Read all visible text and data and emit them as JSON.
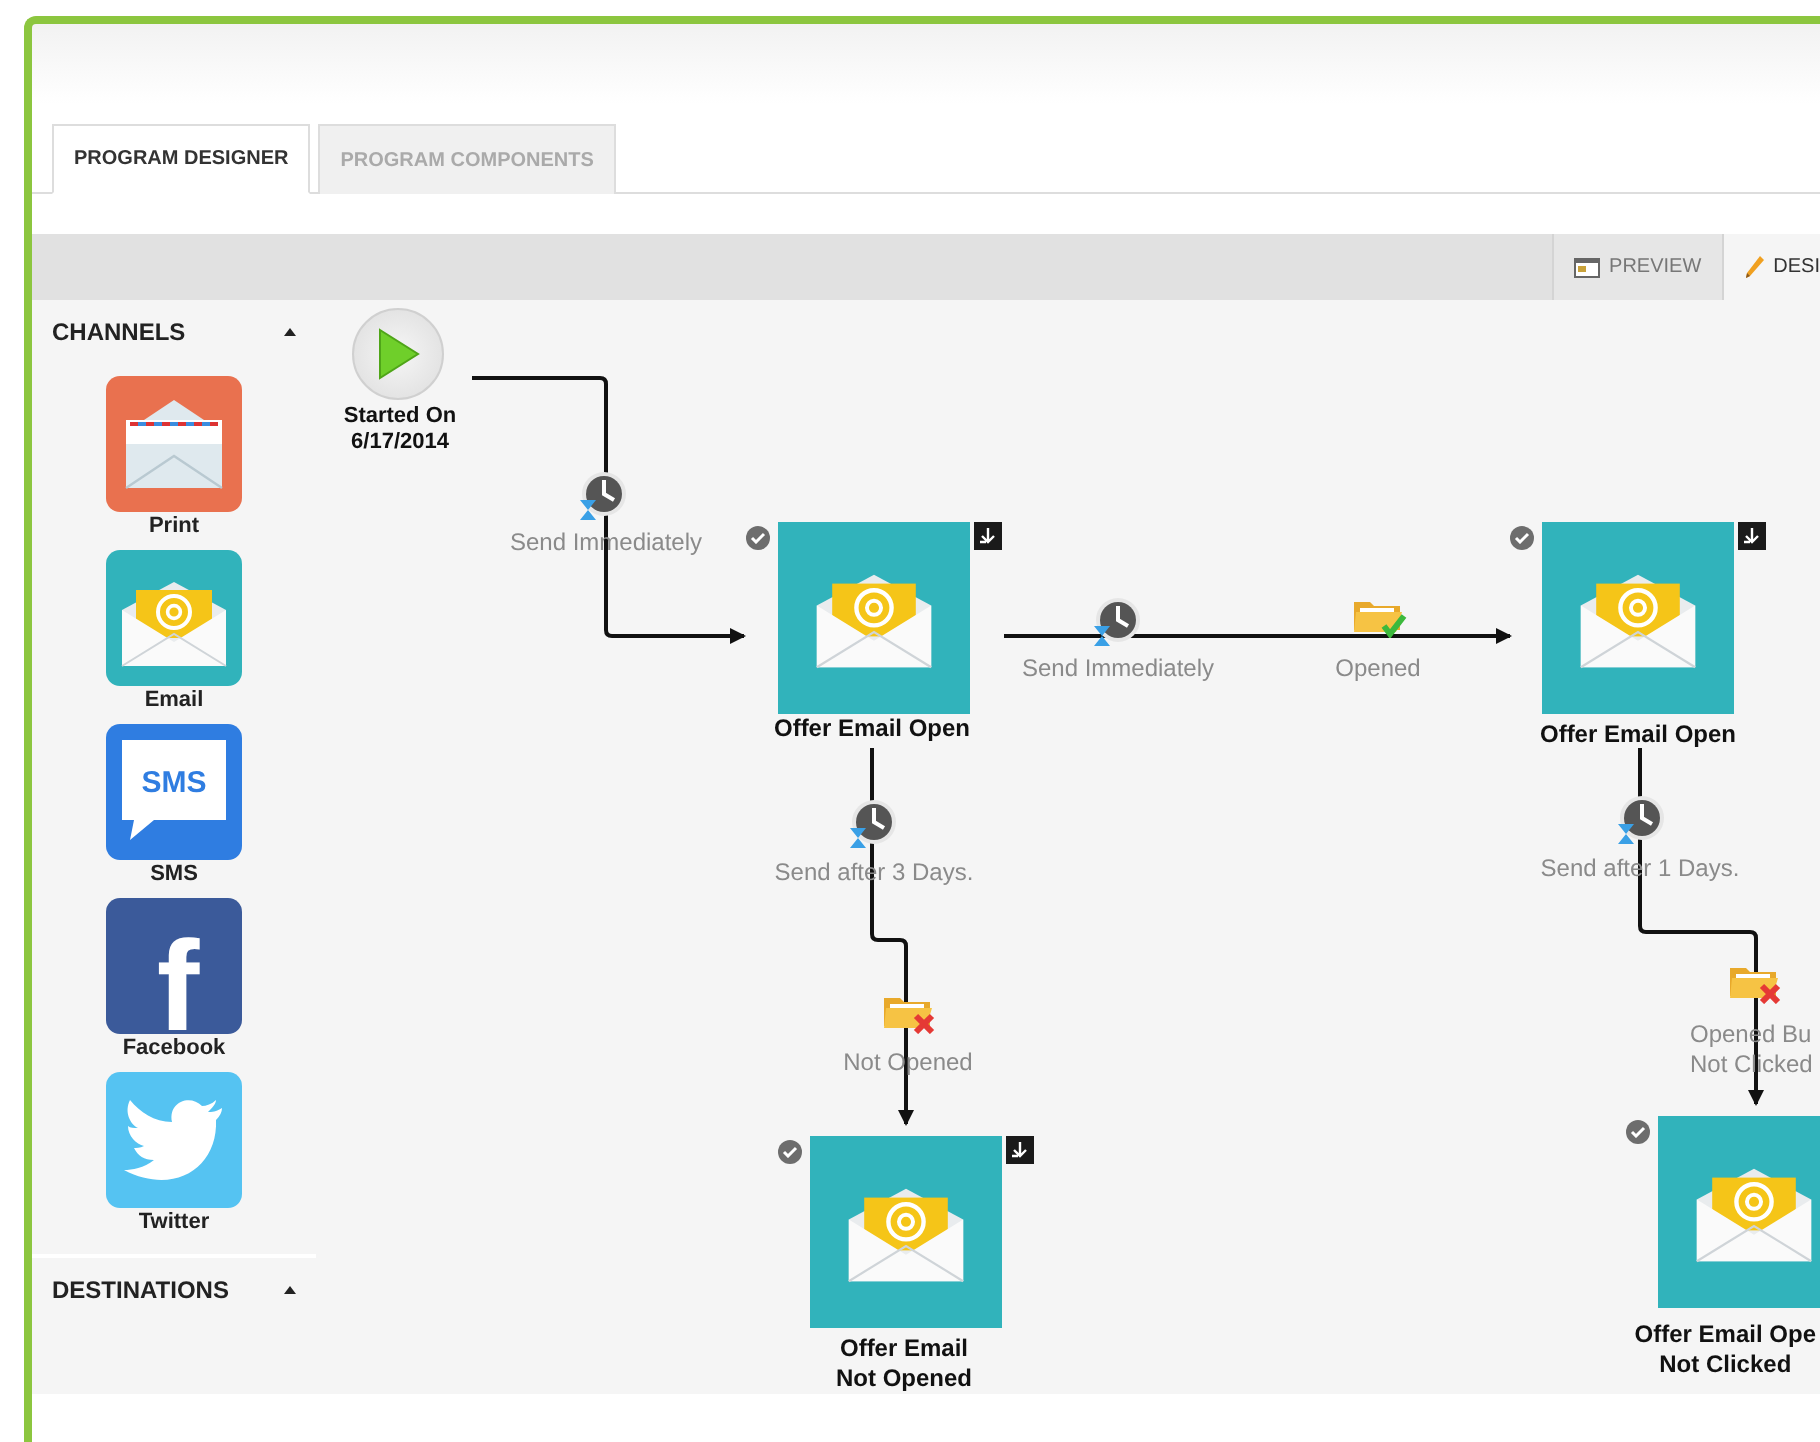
{
  "tabs": [
    {
      "label": "PROGRAM DESIGNER",
      "selected": true
    },
    {
      "label": "PROGRAM COMPONENTS",
      "selected": false
    }
  ],
  "toolbar": {
    "buttons": [
      {
        "label": "PREVIEW",
        "kind": "preview",
        "selected": false
      },
      {
        "label": "DESI",
        "kind": "design",
        "selected": true
      }
    ]
  },
  "sidebar": {
    "sections": [
      {
        "title": "CHANNELS",
        "expanded": true,
        "items": [
          {
            "label": "Print",
            "kind": "print"
          },
          {
            "label": "Email",
            "kind": "email"
          },
          {
            "label": "SMS",
            "kind": "sms",
            "icon_text": "SMS"
          },
          {
            "label": "Facebook",
            "kind": "facebook",
            "icon_text": "f"
          },
          {
            "label": "Twitter",
            "kind": "twitter"
          }
        ]
      },
      {
        "title": "DESTINATIONS",
        "expanded": true
      }
    ]
  },
  "canvas": {
    "start": {
      "label": [
        "Started On",
        "6/17/2014"
      ]
    },
    "nodes": [
      {
        "kind": "email",
        "label": [
          "Offer Email Open"
        ],
        "checked": true,
        "pinned": true
      },
      {
        "kind": "email",
        "label": [
          "Offer Email Open"
        ],
        "checked": true,
        "pinned": true
      },
      {
        "kind": "email",
        "label": [
          "Offer Email",
          "Not Opened"
        ],
        "checked": true,
        "pinned": true
      },
      {
        "kind": "email",
        "label": [
          "Offer Email Ope",
          "Not Clicked"
        ],
        "checked": true
      }
    ],
    "transitions": [
      {
        "kind": "delay",
        "label": [
          "Send Immediately"
        ]
      },
      {
        "kind": "delay",
        "label": [
          "Send Immediately"
        ]
      },
      {
        "kind": "opened",
        "label": [
          "Opened"
        ]
      },
      {
        "kind": "delay",
        "label": [
          "Send after 3 Days."
        ]
      },
      {
        "kind": "not_opened",
        "label": [
          "Not Opened"
        ]
      },
      {
        "kind": "delay",
        "label": [
          "Send after 1 Days."
        ]
      },
      {
        "kind": "not_opened",
        "label": [
          "Opened Bu",
          "Not Clicked"
        ]
      }
    ]
  }
}
